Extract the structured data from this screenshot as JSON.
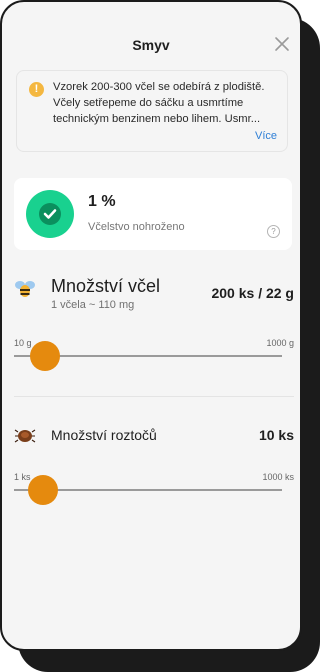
{
  "header": {
    "title": "Smyv"
  },
  "info": {
    "text": "Vzorek 200-300 včel se odebírá z plodiště. Včely setřepeme do sáčku a usmrtíme technickým benzinem nebo lihem. Usmr...",
    "more": "Více",
    "icon_glyph": "!"
  },
  "status": {
    "value": "1 %",
    "label": "Včelstvo nohroženo",
    "help_glyph": "?",
    "color": "#19d18f"
  },
  "bees": {
    "label": "Množství včel",
    "sub": "1 včela ~ 110 mg",
    "value": "200 ks / 22 g",
    "slider": {
      "min_label": "10 g",
      "max_label": "1000 g",
      "fraction": 0.05
    }
  },
  "mites": {
    "label": "Množství roztočů",
    "value": "10 ks",
    "slider": {
      "min_label": "1 ks",
      "max_label": "1000 ks",
      "fraction": 0.04
    }
  },
  "colors": {
    "accent": "#e58a0e",
    "link": "#2e7fd6",
    "warning": "#f4b740"
  }
}
